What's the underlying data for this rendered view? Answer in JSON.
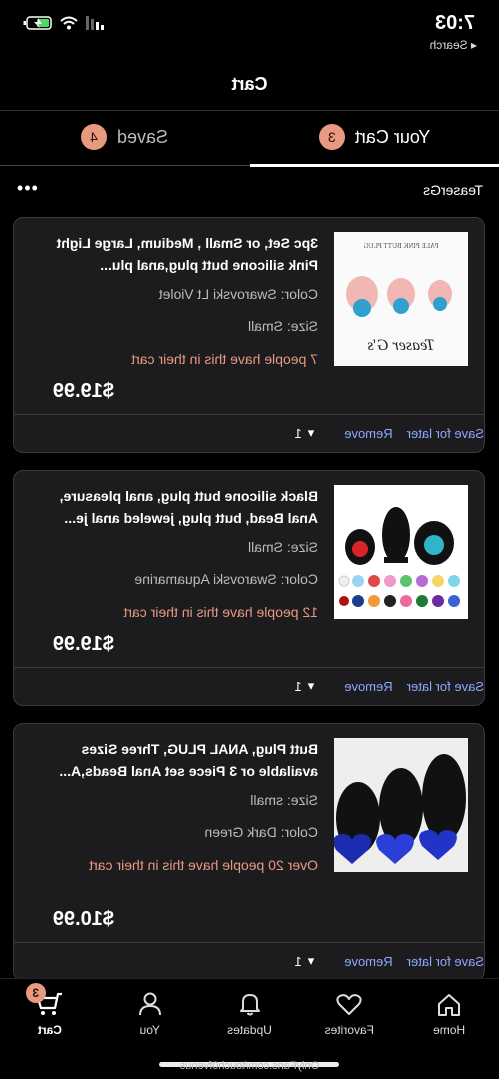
{
  "status": {
    "time": "7:03",
    "back_label": "◂ Search"
  },
  "header": {
    "title": "Cart"
  },
  "tabs": [
    {
      "label": "Your Cart",
      "count": "3"
    },
    {
      "label": "Saved",
      "count": "4"
    }
  ],
  "store": {
    "name": "TeaserGs",
    "more": "•••"
  },
  "items": [
    {
      "name": "3pc Set, or Small , Medium, Large Light Pink silicone butt plug,anal plu...",
      "line1": "Color: Swarovski Lt Violet",
      "line2": "Size: Small",
      "demand": "7 people have this in their cart",
      "price": "$19.99",
      "qty": "1",
      "remove": "Remove",
      "save": "Save for later",
      "thumb_text_top": "PALE PINK BUTT PLUG",
      "thumb_text_bottom": "Teaser G's"
    },
    {
      "name": "Black silicone butt plug, anal pleasure, Anal Bead,  butt plug, jeweled anal je...",
      "line1": "Size: Small",
      "line2": "Color: Swarovski Aquamarine",
      "demand": "12 people have this in their cart",
      "price": "$19.99",
      "qty": "1",
      "remove": "Remove",
      "save": "Save for later"
    },
    {
      "name": "Butt Plug, ANAL PLUG, Three Sizes available or 3 Piece set Anal Beads,A...",
      "line1": "Size: small",
      "line2": "Color: Dark Green",
      "demand": "Over 20 people have this in their cart",
      "price": "$10.99",
      "qty": "1",
      "remove": "Remove",
      "save": "Save for later"
    }
  ],
  "tabbar": [
    {
      "label": "Home",
      "icon": "home-icon"
    },
    {
      "label": "Favorites",
      "icon": "heart-icon"
    },
    {
      "label": "Updates",
      "icon": "bell-icon"
    },
    {
      "label": "You",
      "icon": "person-icon"
    },
    {
      "label": "Cart",
      "icon": "cart-icon",
      "badge": "3"
    }
  ],
  "watermark": "OnlyFans.com/touch0fvenus",
  "colors": {
    "accent": "#e89a80",
    "link": "#8ea8ff",
    "card_bg": "#1c1c1e"
  }
}
